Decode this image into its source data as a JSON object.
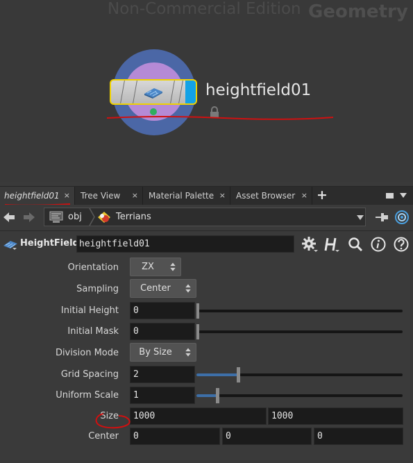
{
  "network": {
    "watermark": "Non-Commercial Edition",
    "context_label": "Geometry",
    "node_name": "heightfield01",
    "colors": {
      "node_flag": "#13a2e6",
      "node_outline": "#f0d200",
      "ring_outer": "#4b67a6",
      "ring_inner": "#b58ad6"
    }
  },
  "tabs": {
    "items": [
      {
        "label": "heightfield01",
        "active": true
      },
      {
        "label": "Tree View"
      },
      {
        "label": "Material Palette"
      },
      {
        "label": "Asset Browser"
      }
    ],
    "close_glyph": "×",
    "add_glyph": "+"
  },
  "path": {
    "root": "obj",
    "current": "Terrians"
  },
  "node": {
    "type_label": "HeightField",
    "name": "heightfield01"
  },
  "params": {
    "orientation": {
      "label": "Orientation",
      "value": "ZX"
    },
    "sampling": {
      "label": "Sampling",
      "value": "Center"
    },
    "initial_height": {
      "label": "Initial Height",
      "value": "0",
      "slider_fraction": 0.0
    },
    "initial_mask": {
      "label": "Initial Mask",
      "value": "0",
      "slider_fraction": 0.0
    },
    "division_mode": {
      "label": "Division Mode",
      "value": "By Size"
    },
    "grid_spacing": {
      "label": "Grid Spacing",
      "value": "2",
      "slider_fraction": 0.2
    },
    "uniform_scale": {
      "label": "Uniform Scale",
      "value": "1",
      "slider_fraction": 0.1
    },
    "size": {
      "label": "Size",
      "x": "1000",
      "y": "1000"
    },
    "center": {
      "label": "Center",
      "x": "0",
      "y": "0",
      "z": "0"
    }
  },
  "icons": [
    "back-arrow-icon",
    "forward-arrow-icon",
    "network-obj-icon",
    "terrain-icon",
    "pin-icon",
    "target-icon",
    "heightfield-icon",
    "gear-icon",
    "houdini-h-icon",
    "magnifier-icon",
    "info-icon",
    "help-icon",
    "lock-icon"
  ]
}
